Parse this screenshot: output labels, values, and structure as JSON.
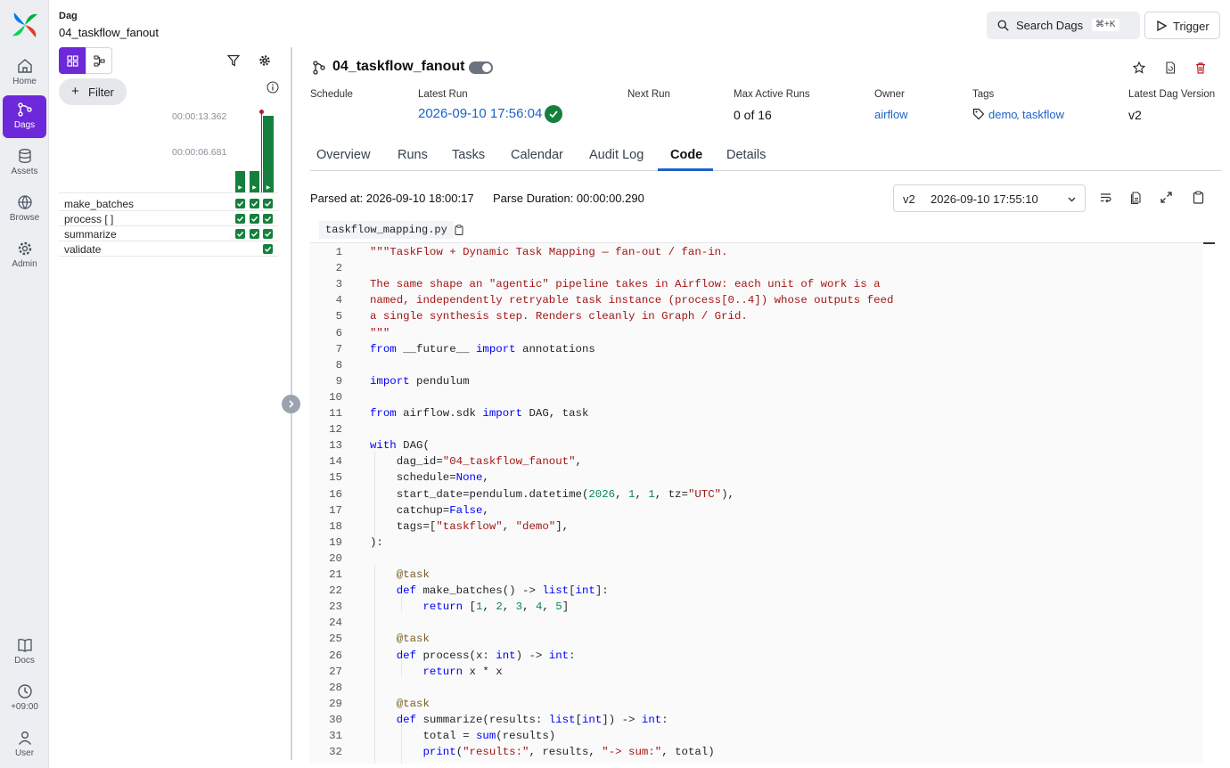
{
  "nav": {
    "items": [
      {
        "label": "Home",
        "icon": "home-icon"
      },
      {
        "label": "Dags",
        "icon": "dags-icon"
      },
      {
        "label": "Assets",
        "icon": "assets-icon"
      },
      {
        "label": "Browse",
        "icon": "globe-icon"
      },
      {
        "label": "Admin",
        "icon": "gear-icon"
      }
    ],
    "bottom": [
      {
        "label": "Docs",
        "icon": "book-icon"
      },
      {
        "label": "+09:00",
        "icon": "clock-icon"
      },
      {
        "label": "User",
        "icon": "user-icon"
      }
    ]
  },
  "header": {
    "label": "Dag",
    "dag_id": "04_taskflow_fanout",
    "search_label": "Search Dags",
    "search_shortcut": "⌘+K",
    "trigger_label": "Trigger"
  },
  "left_panel": {
    "filter_label": "Filter",
    "durations": [
      "00:00:13.362",
      "00:00:06.681"
    ],
    "runs": [
      0.28,
      0.28,
      1.0
    ],
    "tasks": [
      {
        "name": "make_batches",
        "states": [
          "success",
          "success",
          "success"
        ]
      },
      {
        "name": "process [ ]",
        "states": [
          "success",
          "success",
          "success"
        ]
      },
      {
        "name": "summarize",
        "states": [
          "success",
          "success",
          "success"
        ]
      },
      {
        "name": "validate",
        "states": [
          "",
          "",
          "success"
        ]
      }
    ]
  },
  "dag": {
    "title": "04_taskflow_fanout",
    "paused": false,
    "meta": {
      "schedule_h": "Schedule",
      "schedule_v": "",
      "latest_run_h": "Latest Run",
      "latest_run_v": "2026-09-10 17:56:04",
      "next_run_h": "Next Run",
      "next_run_v": "",
      "max_active_h": "Max Active Runs",
      "max_active_v": "0 of 16",
      "owner_h": "Owner",
      "owner_v": "airflow",
      "tags_h": "Tags",
      "tag1": "demo",
      "tag_sep": ",",
      "tag2": "taskflow",
      "version_h": "Latest Dag Version",
      "version_v": "v2"
    }
  },
  "tabs": [
    "Overview",
    "Runs",
    "Tasks",
    "Calendar",
    "Audit Log",
    "Code",
    "Details"
  ],
  "active_tab": "Code",
  "code_view": {
    "parsed_at": "Parsed at: 2026-09-10 18:00:17",
    "parse_duration": "Parse Duration: 00:00:00.290",
    "version": "v2",
    "version_date": "2026-09-10 17:55:10",
    "file_name": "taskflow_mapping.py",
    "lines": [
      "\"\"\"TaskFlow + Dynamic Task Mapping — fan-out / fan-in.",
      "",
      "The same shape an \"agentic\" pipeline takes in Airflow: each unit of work is a",
      "named, independently retryable task instance (process[0..4]) whose outputs feed",
      "a single synthesis step. Renders cleanly in Graph / Grid.",
      "\"\"\"",
      "from __future__ import annotations",
      "",
      "import pendulum",
      "",
      "from airflow.sdk import DAG, task",
      "",
      "with DAG(",
      "    dag_id=\"04_taskflow_fanout\",",
      "    schedule=None,",
      "    start_date=pendulum.datetime(2026, 1, 1, tz=\"UTC\"),",
      "    catchup=False,",
      "    tags=[\"taskflow\", \"demo\"],",
      "):",
      "",
      "    @task",
      "    def make_batches() -> list[int]:",
      "        return [1, 2, 3, 4, 5]",
      "",
      "    @task",
      "    def process(x: int) -> int:",
      "        return x * x",
      "",
      "    @task",
      "    def summarize(results: list[int]) -> int:",
      "        total = sum(results)",
      "        print(\"results:\", results, \"-> sum:\", total)"
    ]
  }
}
